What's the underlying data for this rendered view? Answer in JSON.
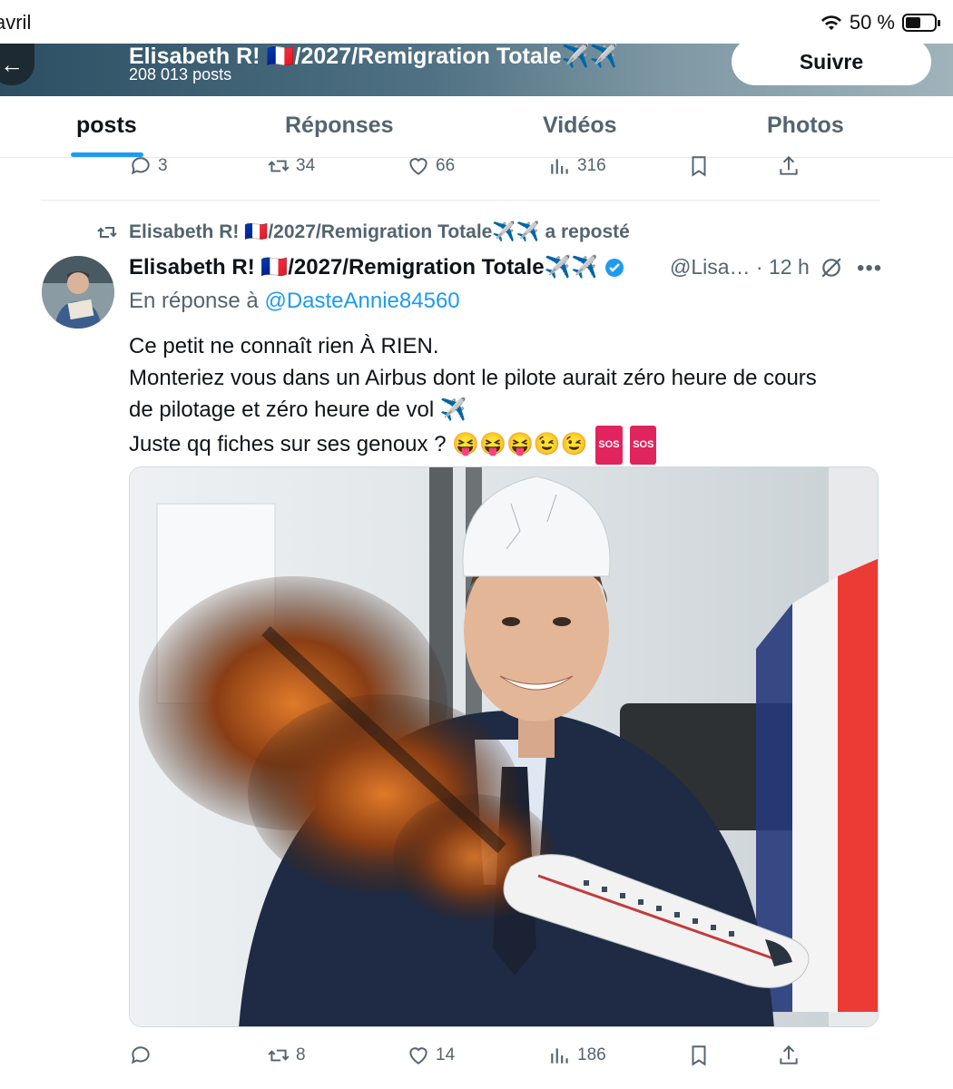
{
  "status_bar": {
    "time": "avril",
    "battery": "50 %"
  },
  "header": {
    "title": "Elisabeth R! 🇫🇷/2027/Remigration Totale✈️✈️",
    "posts_count": "208 013 posts",
    "follow_label": "Suivre"
  },
  "tabs": [
    {
      "label": "posts"
    },
    {
      "label": "Réponses"
    },
    {
      "label": "Vidéos"
    },
    {
      "label": "Photos"
    }
  ],
  "prev_post": {
    "replies": "3",
    "reposts": "34",
    "likes": "66",
    "views": "316"
  },
  "post": {
    "repost_line": "Elisabeth R! 🇫🇷/2027/Remigration Totale✈️✈️ a reposté",
    "author_name": "Elisabeth R! 🇫🇷/2027/Remigration Totale✈️✈️",
    "handle_time": "@Lisa… · 12 h",
    "reply_prefix": "En réponse à",
    "reply_to": "@DasteAnnie84560",
    "lines": [
      "Ce petit ne connaît rien À RIEN.",
      "Monteriez vous dans un Airbus dont le pilote aurait zéro heure de cours",
      "de pilotage et zéro heure de vol ✈️",
      "Juste qq fiches sur ses genoux ? 😝😝😝😉😉"
    ],
    "sos_label": "SOS",
    "replies": "",
    "reposts": "8",
    "likes": "14",
    "views": "186"
  },
  "colors": {
    "accent": "#1d9bf0",
    "muted": "#536471",
    "text": "#0f1419",
    "verified": "#1d9bf0"
  }
}
